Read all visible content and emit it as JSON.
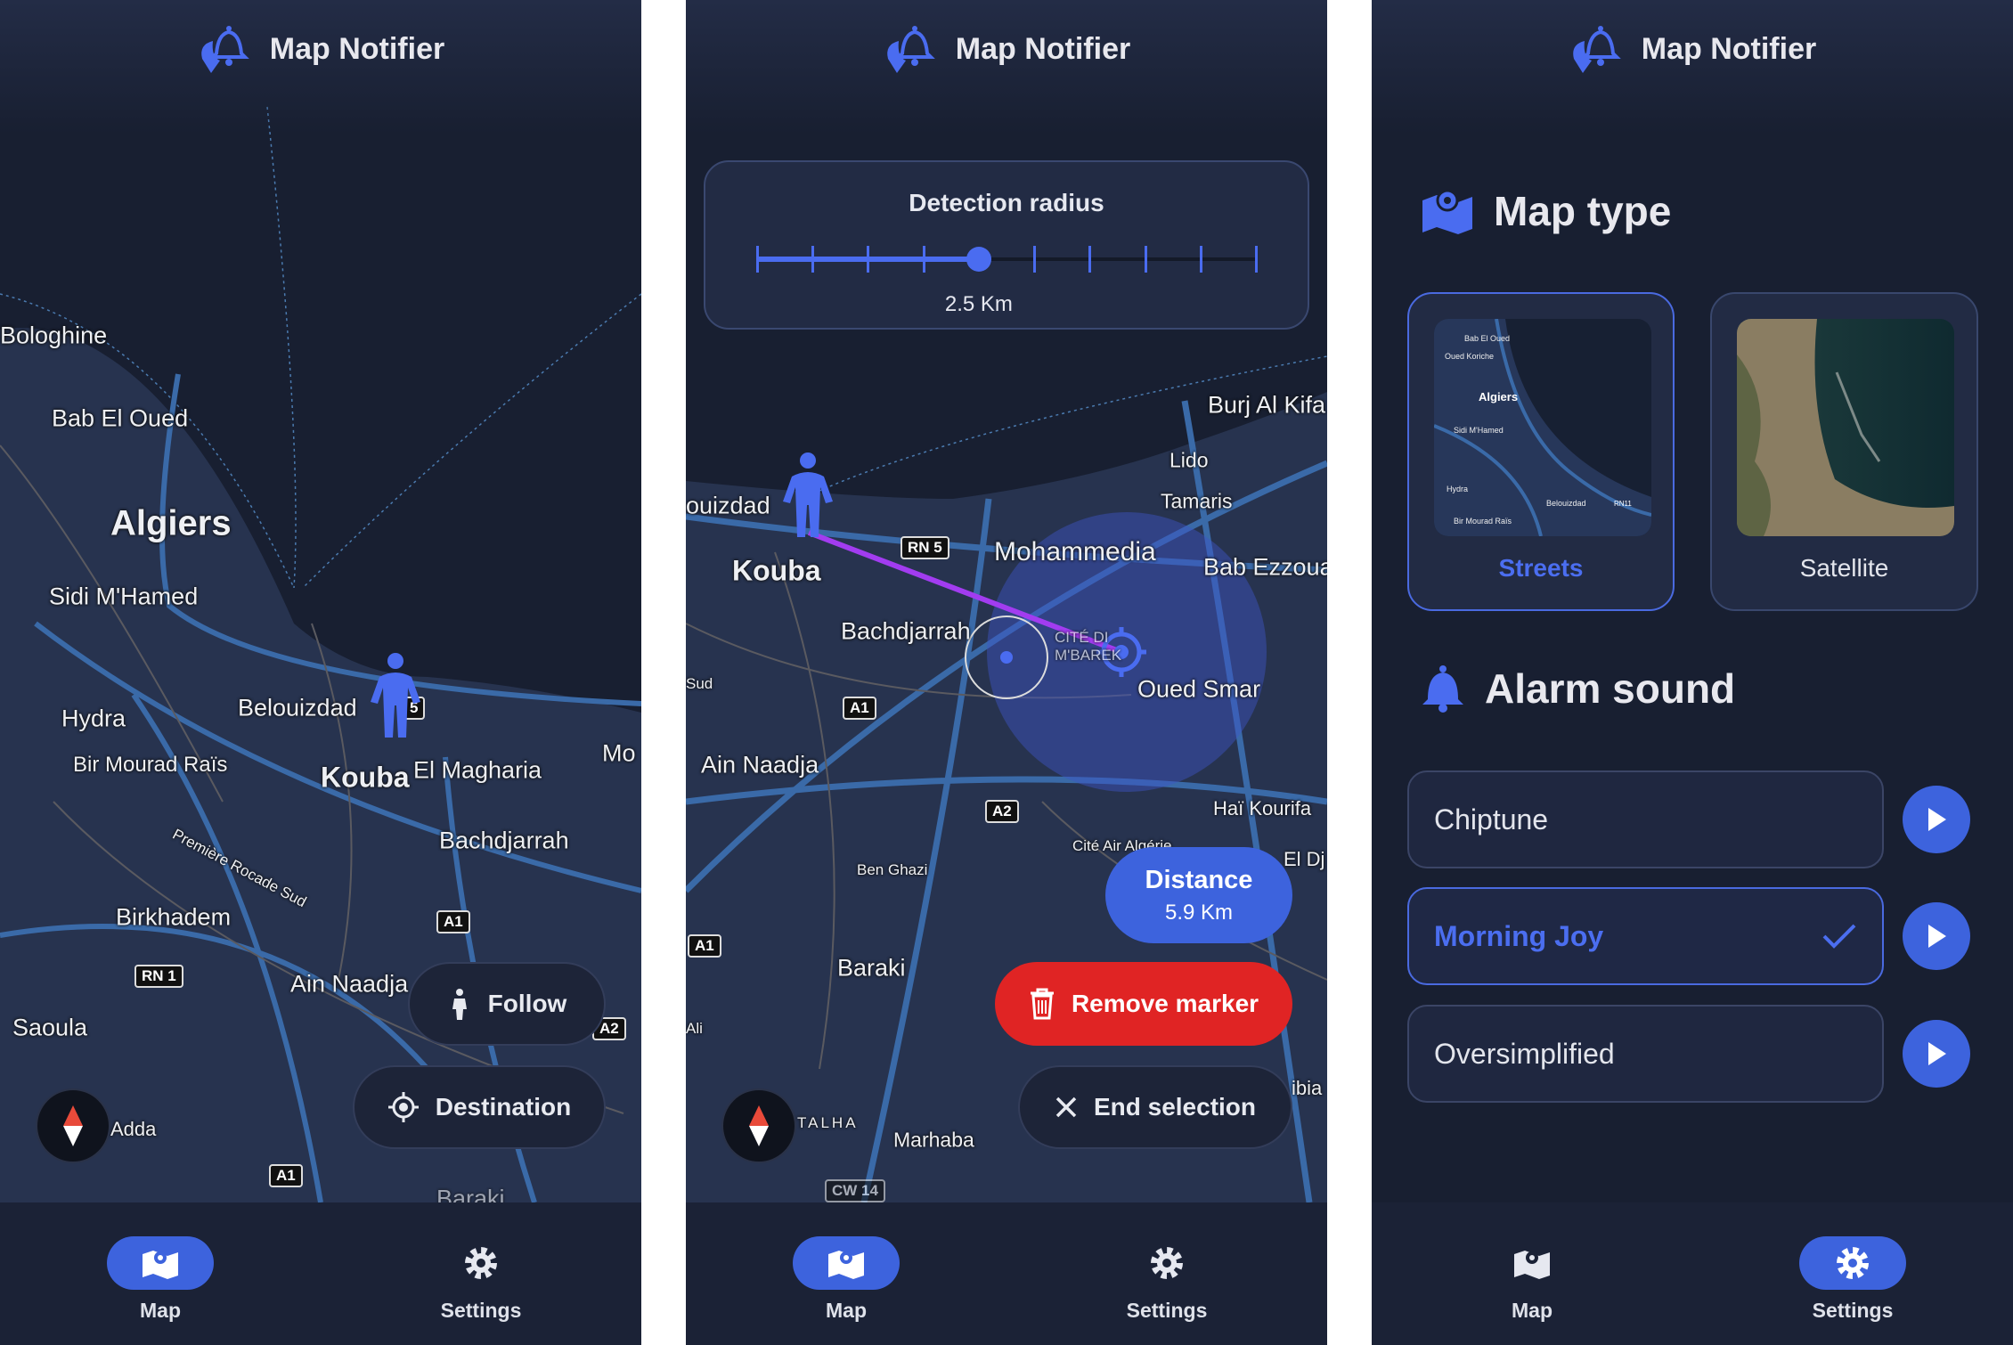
{
  "app": {
    "title": "Map Notifier"
  },
  "nav": {
    "map": "Map",
    "settings": "Settings"
  },
  "colors": {
    "accent": "#3d63dd",
    "danger": "#e02424",
    "route": "#a23cf0",
    "background": "#181f31"
  },
  "screen1": {
    "labels": [
      "Bologhine",
      "Bab El Oued",
      "Algiers",
      "Sidi M'Hamed",
      "Hydra",
      "Belouizdad",
      "Kouba",
      "El Magharia",
      "Bir Mourad Raïs",
      "Bachdjarrah",
      "Birkhadem",
      "Ain Naadja",
      "Saoula",
      "Adda",
      "Mo",
      "Baraki",
      "Première Rocade Sud"
    ],
    "roads": [
      "RN 1",
      "A1",
      "A2",
      "A1",
      "5"
    ],
    "follow": "Follow",
    "destination": "Destination"
  },
  "screen2": {
    "radius_title": "Detection radius",
    "radius_value": "2.5 Km",
    "radius_step": 4,
    "radius_steps": 9,
    "labels": [
      "ouizdad",
      "Kouba",
      "Bachdjarrah",
      "Mohammedia",
      "Burj Al Kifa",
      "Lido",
      "Tamaris",
      "Bab Ezzoua",
      "Oued Smar",
      "Ain Naadja",
      "Haï Kourifa",
      "Ben Ghazi",
      "Baraki",
      "Marhaba",
      "TALHA",
      "Cité Air Algérie",
      "El Dj",
      "Sud",
      "Ali",
      "CITÉ DI M'BAREK",
      "ibia"
    ],
    "roads": [
      "RN 5",
      "A1",
      "A2",
      "A1",
      "CW 14"
    ],
    "distance_label": "Distance",
    "distance_value": "5.9 Km",
    "remove_marker": "Remove marker",
    "end_selection": "End selection"
  },
  "screen3": {
    "map_type_title": "Map type",
    "map_types": [
      {
        "label": "Streets",
        "selected": true
      },
      {
        "label": "Satellite",
        "selected": false
      }
    ],
    "thumb_labels": [
      "Bab El Oued",
      "Oued Koriche",
      "Algiers",
      "Sidi M'Hamed",
      "Hydra",
      "Belouizdad",
      "Bir Mourad Raïs",
      "RN11"
    ],
    "alarm_title": "Alarm sound",
    "sounds": [
      {
        "label": "Chiptune",
        "selected": false
      },
      {
        "label": "Morning Joy",
        "selected": true
      },
      {
        "label": "Oversimplified",
        "selected": false
      }
    ]
  }
}
